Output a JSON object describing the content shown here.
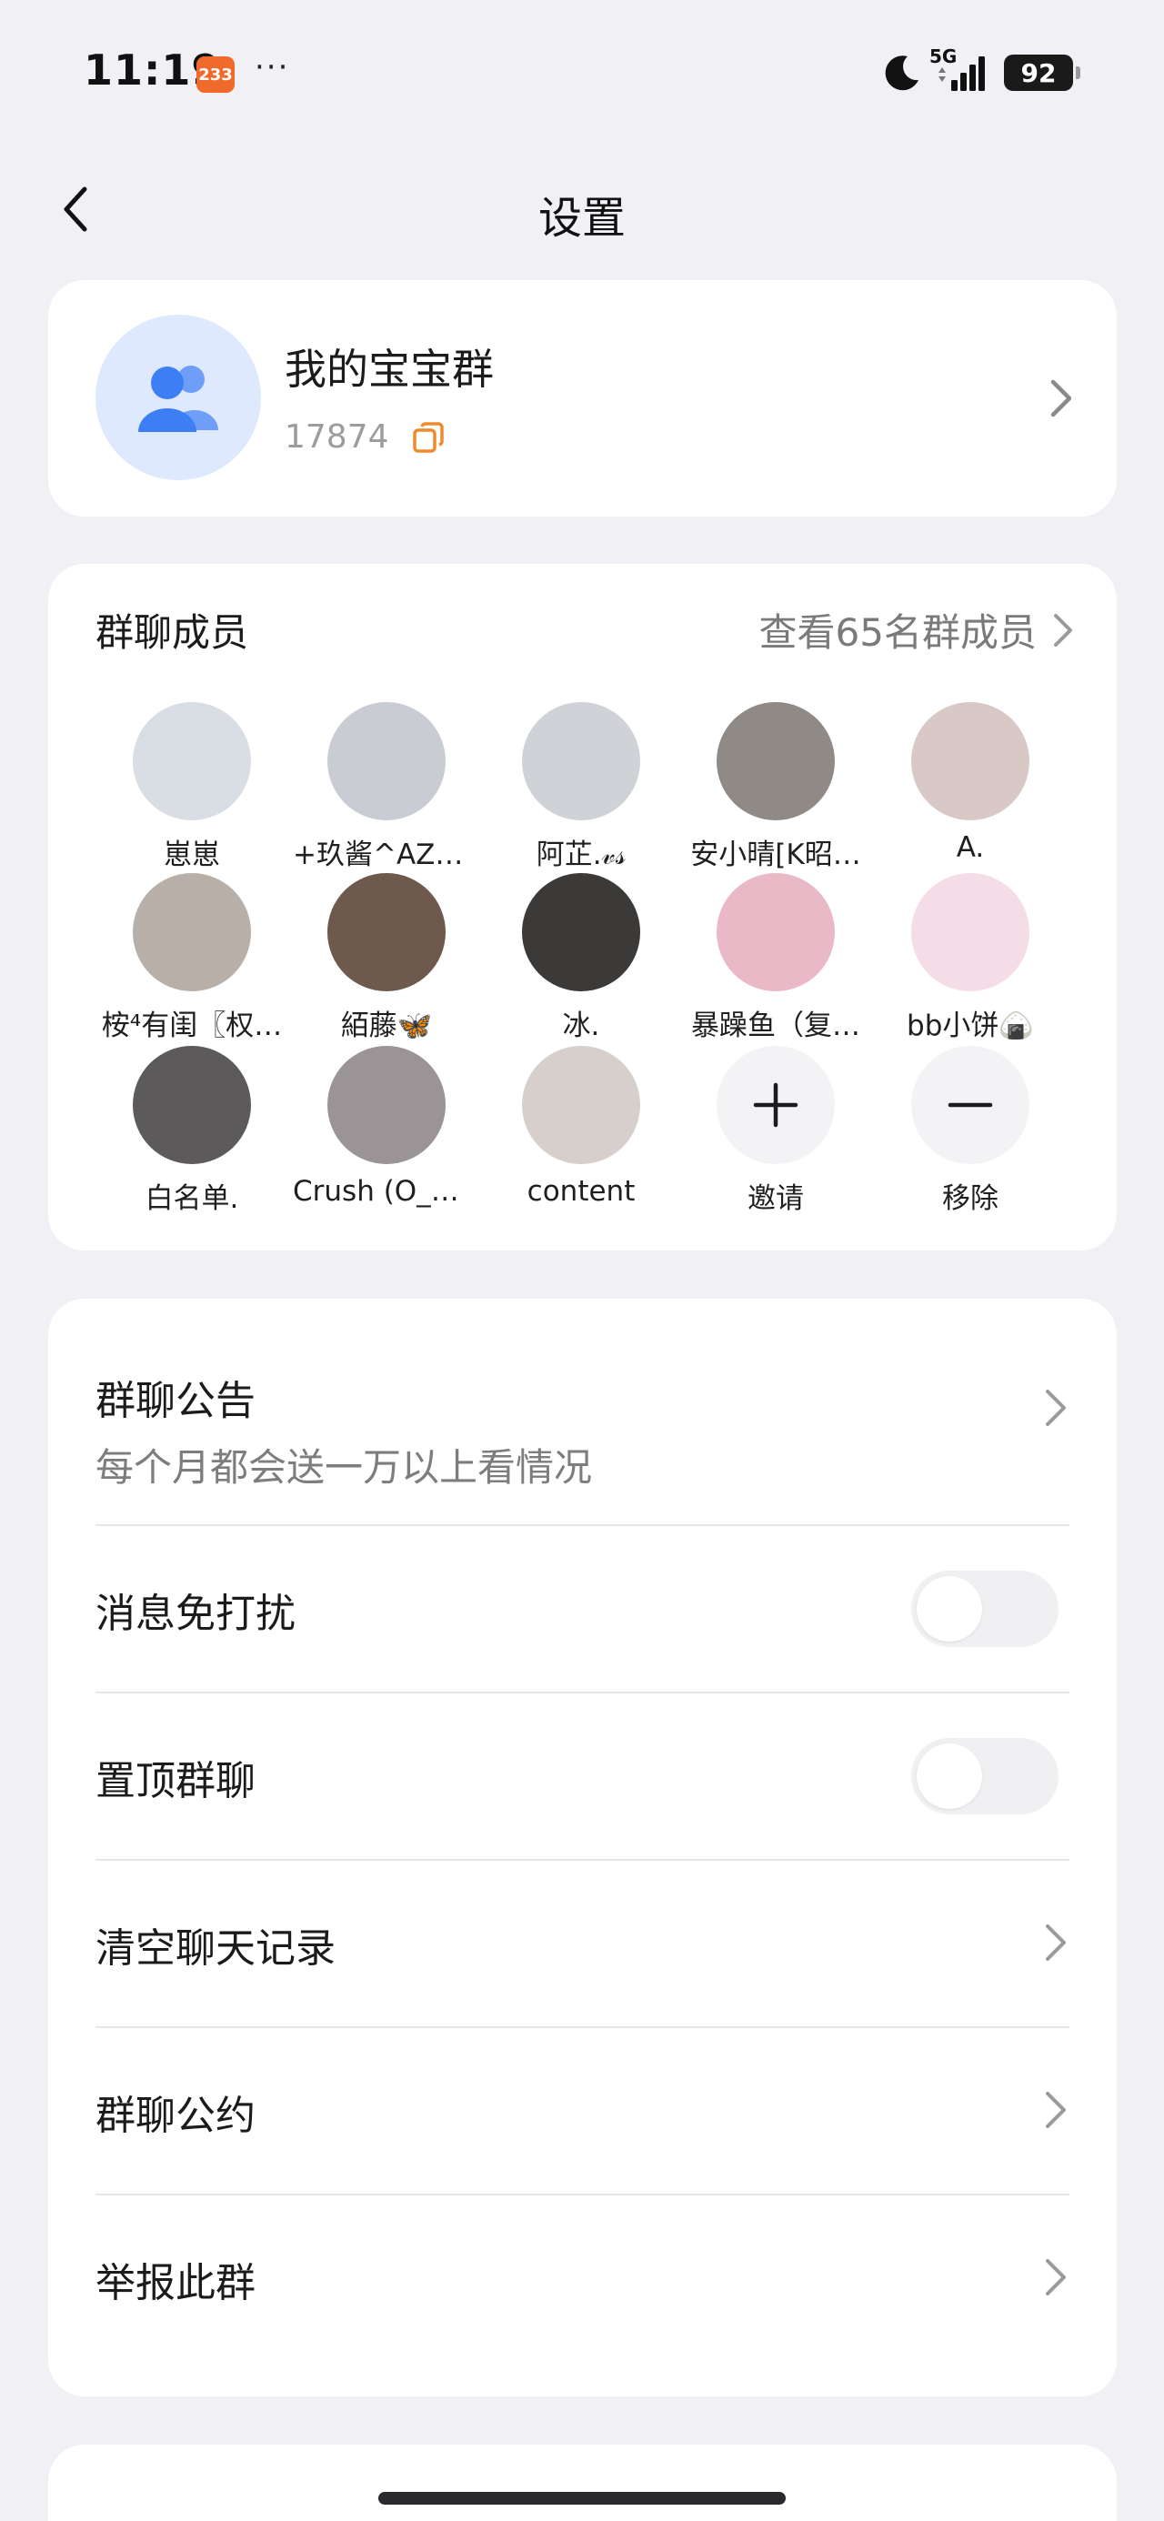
{
  "status_bar": {
    "time": "11:19",
    "app_badge": "233",
    "more": "···",
    "network": "5G",
    "battery": "92"
  },
  "nav": {
    "title": "设置"
  },
  "group": {
    "name": "我的宝宝群",
    "id": "17874",
    "avatar_bg": "#dfe9fd",
    "avatar_icon": "group-icon",
    "icon_color": "#3d7ef5"
  },
  "members": {
    "title": "群聊成员",
    "view_all": "查看65名群成员",
    "list": [
      {
        "name": "崽崽",
        "avatar_color": "#d9dde4"
      },
      {
        "name": "+玖酱^AZ团…",
        "avatar_color": "#c9ccd3"
      },
      {
        "name": "阿芷.𝓋𝓈",
        "avatar_color": "#cfd2d6"
      },
      {
        "name": "安小晴[K昭…",
        "avatar_color": "#8f8a86"
      },
      {
        "name": "A.",
        "avatar_color": "#d8c9c7"
      },
      {
        "name": "桉⁴有闺〖权…",
        "avatar_color": "#b8b0a8"
      },
      {
        "name": "絔藤🦋",
        "avatar_color": "#6e5a4c"
      },
      {
        "name": "冰.",
        "avatar_color": "#3c3a38"
      },
      {
        "name": "暴躁鱼（复…",
        "avatar_color": "#eab9c8"
      },
      {
        "name": "bb小饼🍙",
        "avatar_color": "#f5dde8"
      },
      {
        "name": "白名单.",
        "avatar_color": "#5d5a5c"
      },
      {
        "name": "Crush (O_O…",
        "avatar_color": "#9a9496"
      },
      {
        "name": "content",
        "avatar_color": "#d6cfcc"
      }
    ],
    "invite_label": "邀请",
    "remove_label": "移除"
  },
  "settings": {
    "announcement_label": "群聊公告",
    "announcement_text": "每个月都会送一万以上看情况",
    "dnd_label": "消息免打扰",
    "dnd_on": false,
    "pin_label": "置顶群聊",
    "pin_on": false,
    "clear_label": "清空聊天记录",
    "rules_label": "群聊公约",
    "report_label": "举报此群"
  }
}
